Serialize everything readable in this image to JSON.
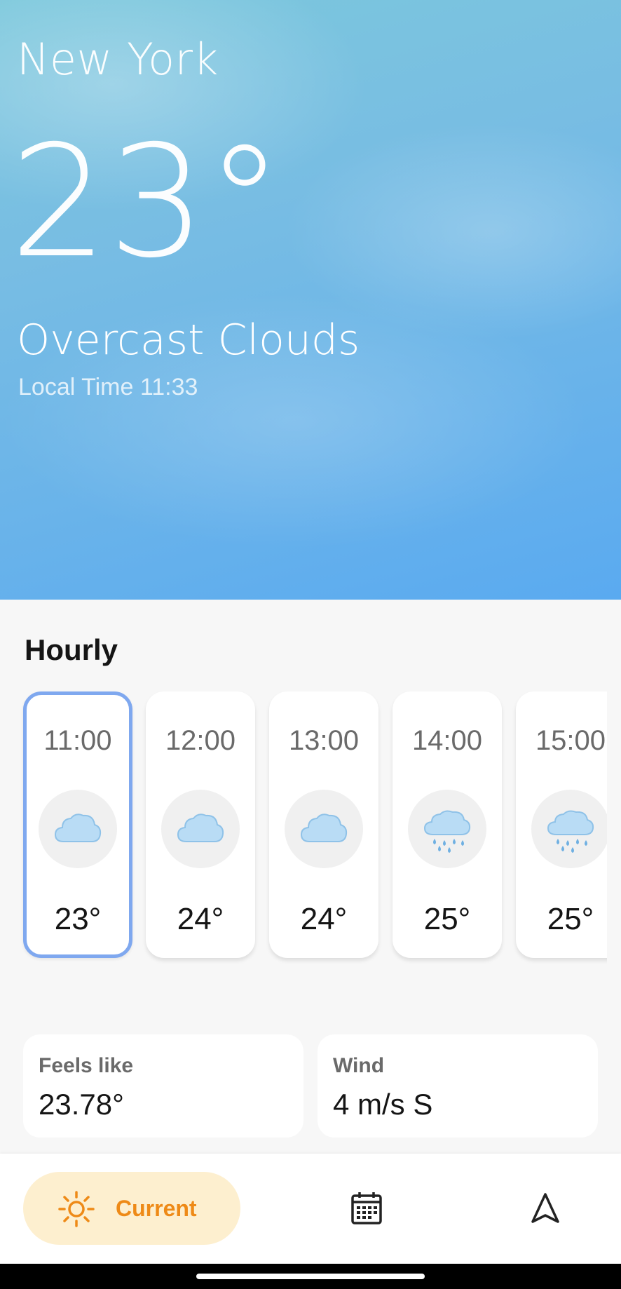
{
  "header": {
    "city": "New York",
    "temperature": "23°",
    "condition": "Overcast Clouds",
    "local_time": "Local Time 11:33"
  },
  "hourly": {
    "title": "Hourly",
    "items": [
      {
        "time": "11:00",
        "icon": "cloud-icon",
        "temp": "23°",
        "selected": true
      },
      {
        "time": "12:00",
        "icon": "cloud-icon",
        "temp": "24°"
      },
      {
        "time": "13:00",
        "icon": "cloud-icon",
        "temp": "24°"
      },
      {
        "time": "14:00",
        "icon": "rain-cloud-icon",
        "temp": "25°"
      },
      {
        "time": "15:00",
        "icon": "rain-cloud-icon",
        "temp": "25°"
      }
    ]
  },
  "details": {
    "feels_like": {
      "label": "Feels like",
      "value": "23.78°"
    },
    "wind": {
      "label": "Wind",
      "value": "4 m/s S"
    }
  },
  "nav": {
    "current_label": "Current",
    "current_icon": "sun-icon",
    "forecast_icon": "calendar-icon",
    "location_icon": "navigation-arrow-icon",
    "accent": "#ee8a17"
  }
}
